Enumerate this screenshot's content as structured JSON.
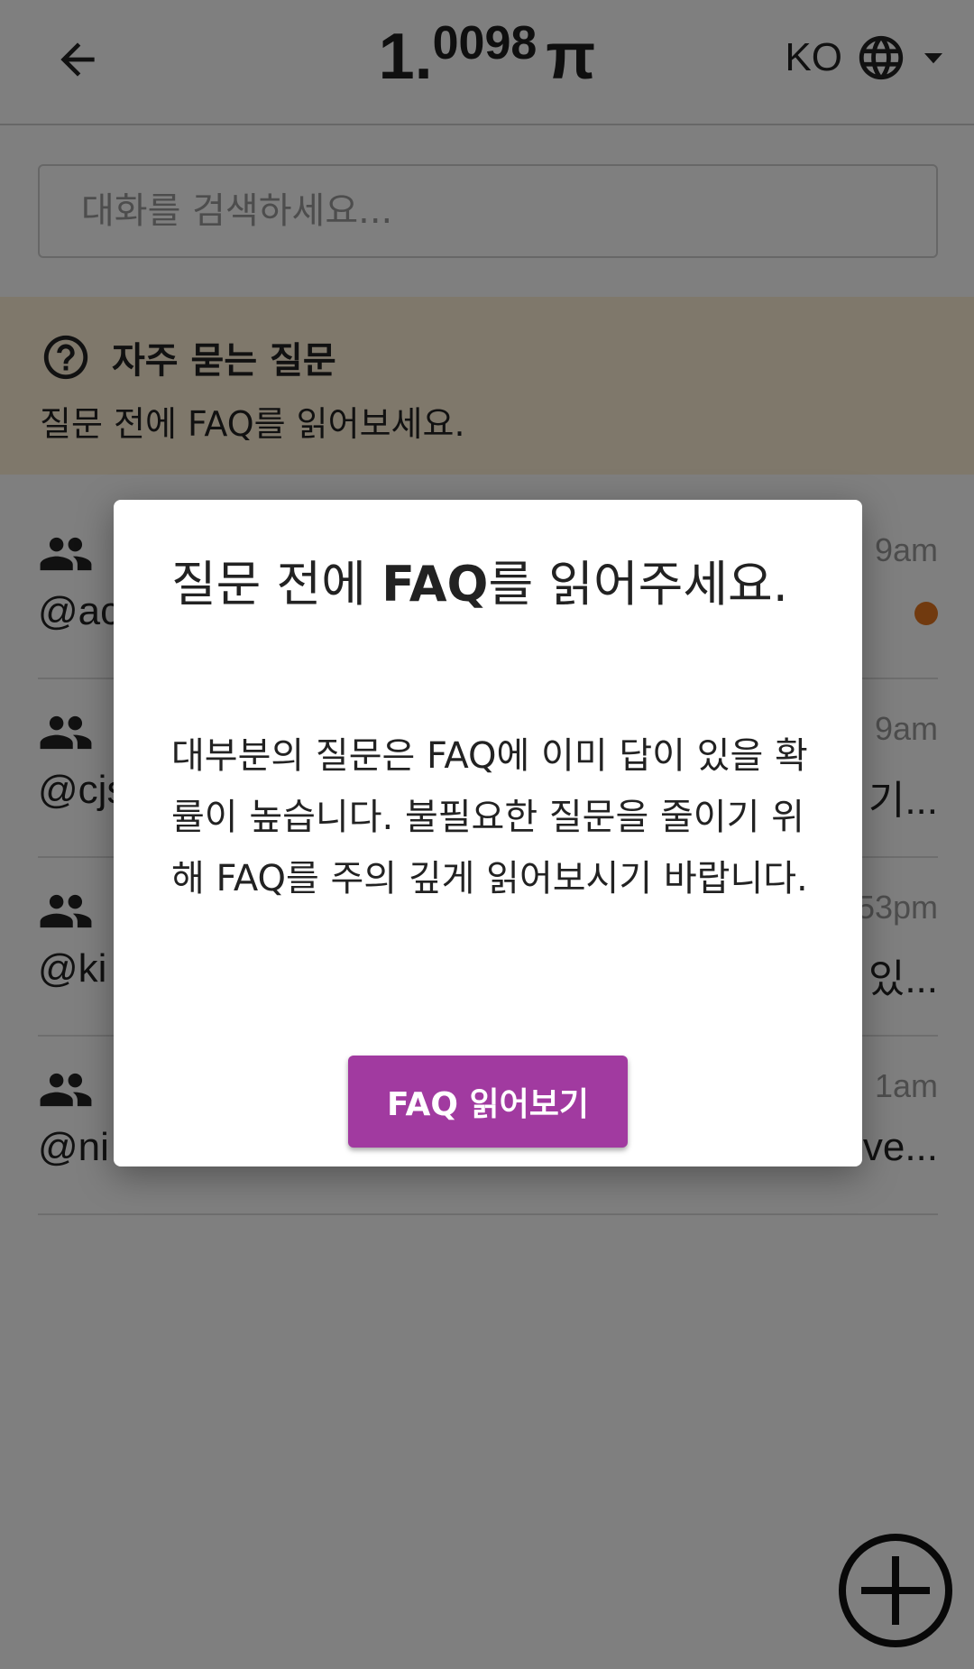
{
  "header": {
    "balance_int": "1.",
    "balance_dec": "0098",
    "currency_symbol": "π",
    "language_code": "KO"
  },
  "search": {
    "placeholder": "대화를 검색하세요..."
  },
  "faq_banner": {
    "title": "자주 묻는 질문",
    "subtitle": "질문 전에 FAQ를 읽어보세요."
  },
  "chats": [
    {
      "user": "@ac",
      "time": "9am",
      "preview": "",
      "unread": true
    },
    {
      "user": "@cjs",
      "time": "9am",
      "preview": "기...",
      "unread": false
    },
    {
      "user": "@ki",
      "time": "53pm",
      "preview": "있...",
      "unread": false
    },
    {
      "user": "@ni",
      "time": "1am",
      "preview": "ve...",
      "unread": false
    }
  ],
  "dialog": {
    "title_pre": "질문 전에 ",
    "title_bold": "FAQ",
    "title_post": "를 읽어주세요.",
    "body": "대부분의 질문은 FAQ에 이미 답이 있을 확률이 높습니다. 불필요한 질문을 줄이기 위해 FAQ를 주의 깊게 읽어보시기 바랍니다.",
    "button_label": "FAQ 읽어보기"
  },
  "colors": {
    "banner_bg": "#fff0d7",
    "accent_button": "#a13aa0",
    "unread_dot": "#e2751f",
    "overlay": "rgba(0,0,0,0.5)"
  }
}
